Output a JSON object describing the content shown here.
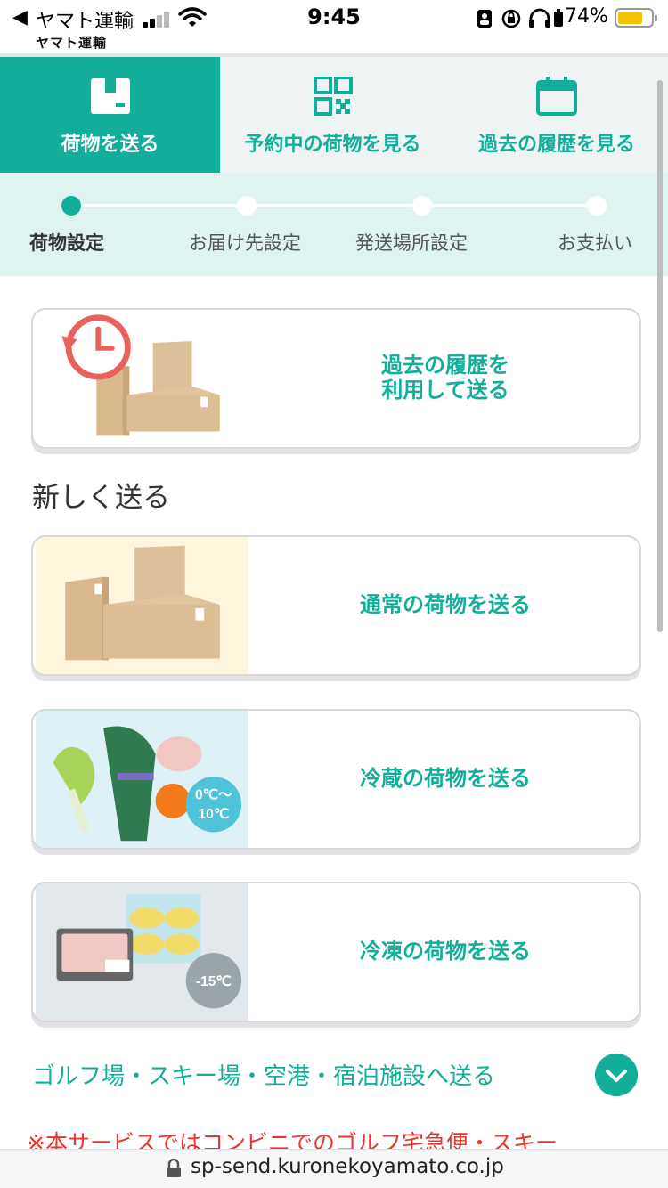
{
  "status_bar": {
    "back_glyph": "◀",
    "carrier": "ヤマト運輸",
    "time": "9:45",
    "battery_percent_text": "74%",
    "battery_level": 0.74,
    "icons": [
      "signal-icon",
      "wifi-icon",
      "portrait-lock-icon",
      "rotation-lock-icon",
      "headphones-icon",
      "battery-icon"
    ]
  },
  "header": {
    "brand": "ヤマト運輸"
  },
  "tabs": [
    {
      "label": "荷物を送る",
      "icon": "box-icon",
      "active": true
    },
    {
      "label": "予約中の荷物を見る",
      "icon": "qr-code-icon",
      "active": false
    },
    {
      "label": "過去の履歴を見る",
      "icon": "calendar-icon",
      "active": false
    }
  ],
  "stepper": {
    "steps": [
      {
        "label": "荷物設定",
        "active": true
      },
      {
        "label": "お届け先設定",
        "active": false
      },
      {
        "label": "発送場所設定",
        "active": false
      },
      {
        "label": "お支払い",
        "active": false
      }
    ]
  },
  "history_card": {
    "label_line1": "過去の履歴を",
    "label_line2": "利用して送る",
    "icon": "history-clock-icon"
  },
  "new_send": {
    "title": "新しく送る",
    "cards": [
      {
        "label": "通常の荷物を送る",
        "image": "boxes-illustration"
      },
      {
        "label": "冷蔵の荷物を送る",
        "image": "vegetables-illustration",
        "badge_line1": "0℃～",
        "badge_line2": "10℃"
      },
      {
        "label": "冷凍の荷物を送る",
        "image": "frozen-food-illustration",
        "badge": "-15℃"
      }
    ]
  },
  "golf": {
    "label": "ゴルフ場・スキー場・空港・宿泊施設へ送る",
    "icon": "chevron-down-icon"
  },
  "notice": "※本サービスではコンビニでのゴルフ宅急便・スキー",
  "url_bar": {
    "url": "sp-send.kuronekoyamato.co.jp"
  },
  "colors": {
    "accent": "#12ae9a",
    "stepper_bg": "#dff4f0",
    "notice": "#e8362c"
  }
}
